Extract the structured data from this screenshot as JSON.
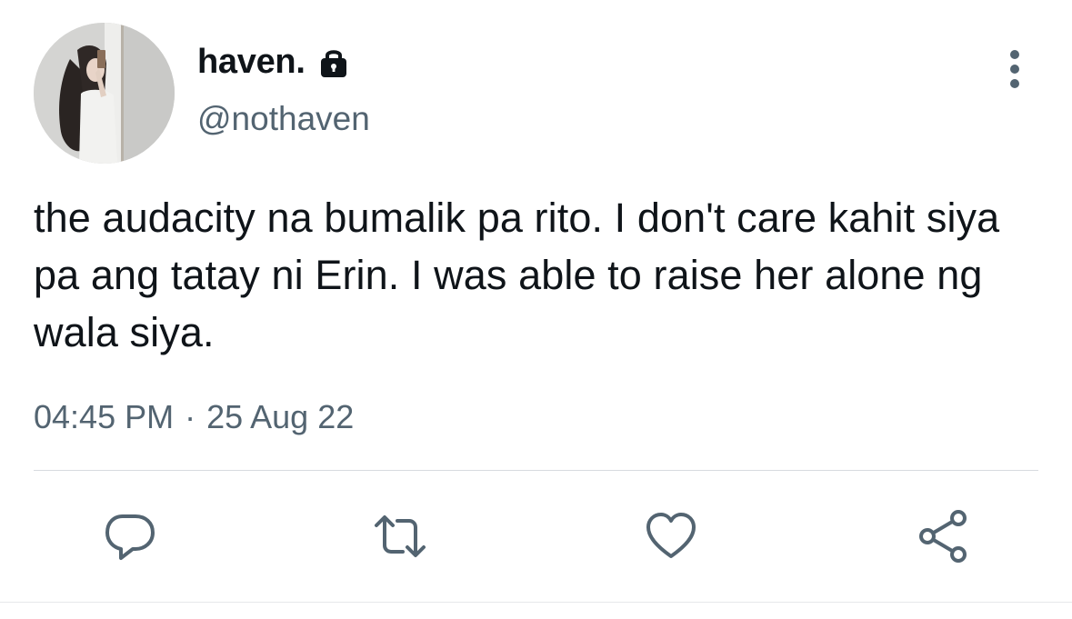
{
  "author": {
    "display_name": "haven.",
    "handle": "@nothaven",
    "avatar_icon": "profile-photo",
    "protected_icon": "lock-icon"
  },
  "tweet": {
    "text": "the audacity na bumalik pa rito. I don't care kahit siya pa ang tatay ni Erin. I was able to raise her alone ng wala siya.",
    "time": "04:45 PM",
    "separator": "·",
    "date": "25 Aug 22"
  },
  "actions": [
    {
      "name": "reply",
      "icon": "reply-icon"
    },
    {
      "name": "retweet",
      "icon": "retweet-icon"
    },
    {
      "name": "like",
      "icon": "heart-icon"
    },
    {
      "name": "share",
      "icon": "share-icon"
    }
  ],
  "colors": {
    "text_primary": "#0f1419",
    "text_secondary": "#536471",
    "divider": "#d7dbdf",
    "icon": "#536471"
  }
}
